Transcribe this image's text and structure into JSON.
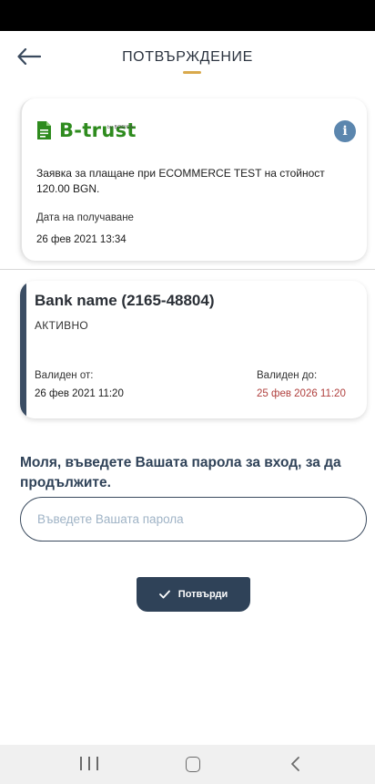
{
  "header": {
    "title": "ПОТВЪРЖДЕНИЕ"
  },
  "request": {
    "brand": "B-trust",
    "brand_sub": "by BORICA",
    "description": "Заявка за плащане при ECOMMERCE TEST на стойност 120.00 BGN.",
    "received_label": "Дата на получаване",
    "received_value": "26 фев 2021 13:34"
  },
  "certificate": {
    "name": "Bank name (2165-48804)",
    "status": "АКТИВНО",
    "valid_from_label": "Валиден от:",
    "valid_from_value": "26 фев 2021 11:20",
    "valid_to_label": "Валиден до:",
    "valid_to_value": "25 фев 2026 11:20"
  },
  "form": {
    "prompt": "Моля, въведете Вашата парола за вход, за да продължите.",
    "password_placeholder": "Въведете Вашата парола",
    "password_value": "",
    "confirm_label": "Потвърди"
  },
  "icons": {
    "back": "arrow-left-icon",
    "info": "info-icon",
    "check": "check-icon",
    "document": "document-icon"
  },
  "colors": {
    "primary": "#2f4258",
    "accent": "#d9a94c",
    "brand_green": "#2e8b1e",
    "expiry_red": "#b0403e",
    "info_blue": "#5b86ae"
  }
}
